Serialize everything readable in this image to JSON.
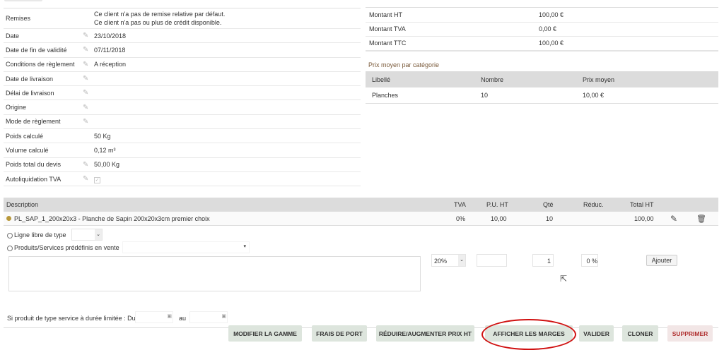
{
  "details": [
    {
      "label": "Remises",
      "value": [
        "Ce client n'a pas de remise relative par défaut.",
        "Ce client n'a pas ou plus de crédit disponible."
      ],
      "editable": false
    },
    {
      "label": "Date",
      "value": "23/10/2018",
      "editable": true
    },
    {
      "label": "Date de fin de validité",
      "value": "07/11/2018",
      "editable": true
    },
    {
      "label": "Conditions de règlement",
      "value": "A réception",
      "editable": true
    },
    {
      "label": "Date de livraison",
      "value": "",
      "editable": true
    },
    {
      "label": "Délai de livraison",
      "value": "",
      "editable": true
    },
    {
      "label": "Origine",
      "value": "",
      "editable": true
    },
    {
      "label": "Mode de règlement",
      "value": "",
      "editable": true
    },
    {
      "label": "Poids calculé",
      "value": "50 Kg",
      "editable": false
    },
    {
      "label": "Volume calculé",
      "value": "0,12 m³",
      "editable": false
    },
    {
      "label": "Poids total du devis",
      "value": "50,00 Kg",
      "editable": true
    },
    {
      "label": "Autoliquidation TVA",
      "value": "",
      "editable": true,
      "checkbox": true
    }
  ],
  "totals": [
    {
      "label": "Montant HT",
      "value": "100,00 €"
    },
    {
      "label": "Montant TVA",
      "value": "0,00 €"
    },
    {
      "label": "Montant TTC",
      "value": "100,00 €"
    }
  ],
  "avg_price": {
    "title": "Prix moyen par catégorie",
    "headers": [
      "Libellé",
      "Nombre",
      "Prix moyen"
    ],
    "rows": [
      [
        "Planches",
        "10",
        "10,00 €"
      ]
    ]
  },
  "lines": {
    "headers": {
      "description": "Description",
      "tva": "TVA",
      "pu": "P.U. HT",
      "qty": "Qté",
      "reduc": "Réduc.",
      "total": "Total HT"
    },
    "rows": [
      {
        "ref": "PL_SAP_1_200x20x3",
        "label": " - Planche de Sapin 200x20x3cm premier choix",
        "tva": "0%",
        "pu": "10,00",
        "qty": "10",
        "reduc": "",
        "total": "100,00"
      }
    ]
  },
  "add_form": {
    "free_line_label": "Ligne libre de type",
    "predefined_label": "Produits/Services prédéfinis en vente",
    "tva": "20%",
    "qty": "1",
    "reduc": "0 %",
    "add_button": "Ajouter",
    "service_label": "Si produit de type service à durée limitée : Du",
    "to_label": "au"
  },
  "actions": [
    "MODIFIER LA GAMME",
    "FRAIS DE PORT",
    "RÉDUIRE/AUGMENTER PRIX HT",
    "AFFICHER LES MARGES",
    "VALIDER",
    "CLONER",
    "SUPPRIMER"
  ],
  "colors": {
    "action_bg": "#dde5dd",
    "delete_text": "#b03030",
    "highlight": "#d01010"
  }
}
